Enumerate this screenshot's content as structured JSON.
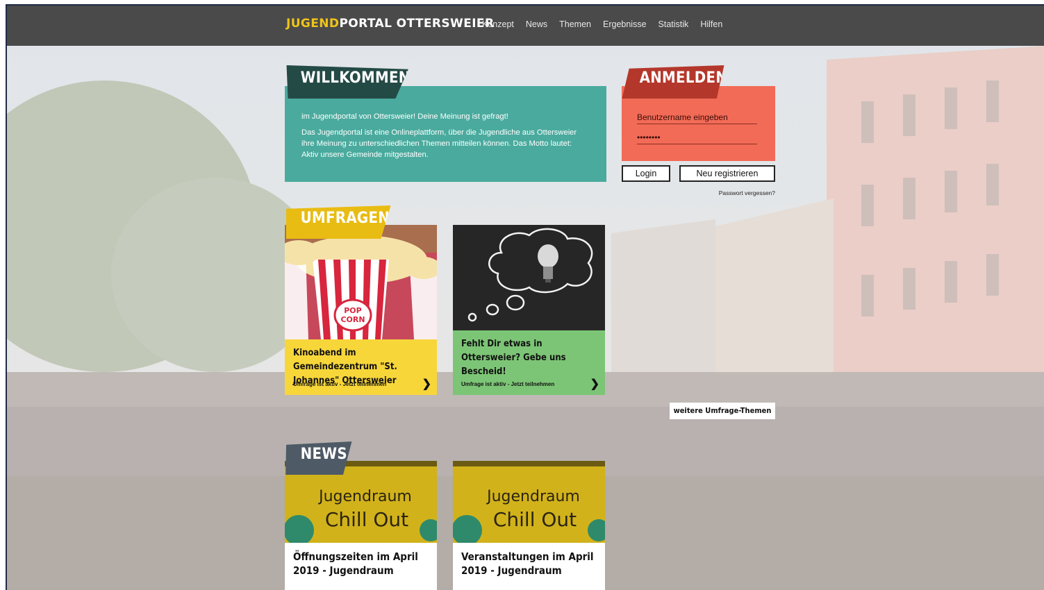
{
  "brand": {
    "logo_highlight": "JUGEND",
    "logo_rest": "PORTAL OTTERSWEIER"
  },
  "nav": [
    "Konzept",
    "News",
    "Themen",
    "Ergebnisse",
    "Statistik",
    "Hilfen"
  ],
  "welcome": {
    "title": "WILLKOMMEN",
    "line1": "im Jugendportal von Ottersweier! Deine Meinung ist gefragt!",
    "line2": "Das Jugendportal ist eine Onlineplattform, über die Jugendliche aus Ottersweier ihre Meinung zu unterschiedlichen Themen mitteilen können. Das Motto lautet: Aktiv unsere Gemeinde mitgestalten."
  },
  "login": {
    "title": "ANMELDEN",
    "username_placeholder": "Benutzername eingeben",
    "password_value": "••••••••",
    "login_button": "Login",
    "register_button": "Neu registrieren",
    "forgot_link": "Passwort vergessen?"
  },
  "surveys": {
    "title": "UMFRAGEN",
    "cards": [
      {
        "title": "Kinoabend im Gemeindezentrum \"St. Johannes\" Ottersweier",
        "footer": "Umfrage ist aktiv - Jetzt teilnehmen",
        "color": "#f7d63a",
        "image_text": [
          "POP",
          "CORN"
        ]
      },
      {
        "title": "Fehlt Dir etwas in Ottersweier? Gebe uns Bescheid!",
        "footer": "Umfrage ist aktiv - Jetzt teilnehmen",
        "color": "#7cc576"
      }
    ],
    "more_button": "weitere Umfrage-Themen"
  },
  "news": {
    "title": "NEWS",
    "image_text": [
      "Jugendraum",
      "Chill Out"
    ],
    "cards": [
      {
        "title": "Öffnungszeiten im April 2019 - Jugendraum"
      },
      {
        "title": "Veranstaltungen im April 2019 - Jugendraum"
      }
    ]
  },
  "colors": {
    "topbar": "#4a4a4a",
    "logo_highlight": "#f0c419",
    "welcome_bg": "#4aaa9e",
    "welcome_tab": "#244a46",
    "login_bg": "#f26b57",
    "login_tab": "#b4372b",
    "survey_tab": "#e8bc12",
    "news_tab": "#4e5a66"
  },
  "icons": {
    "card_arrow": "chevron-right-icon"
  }
}
